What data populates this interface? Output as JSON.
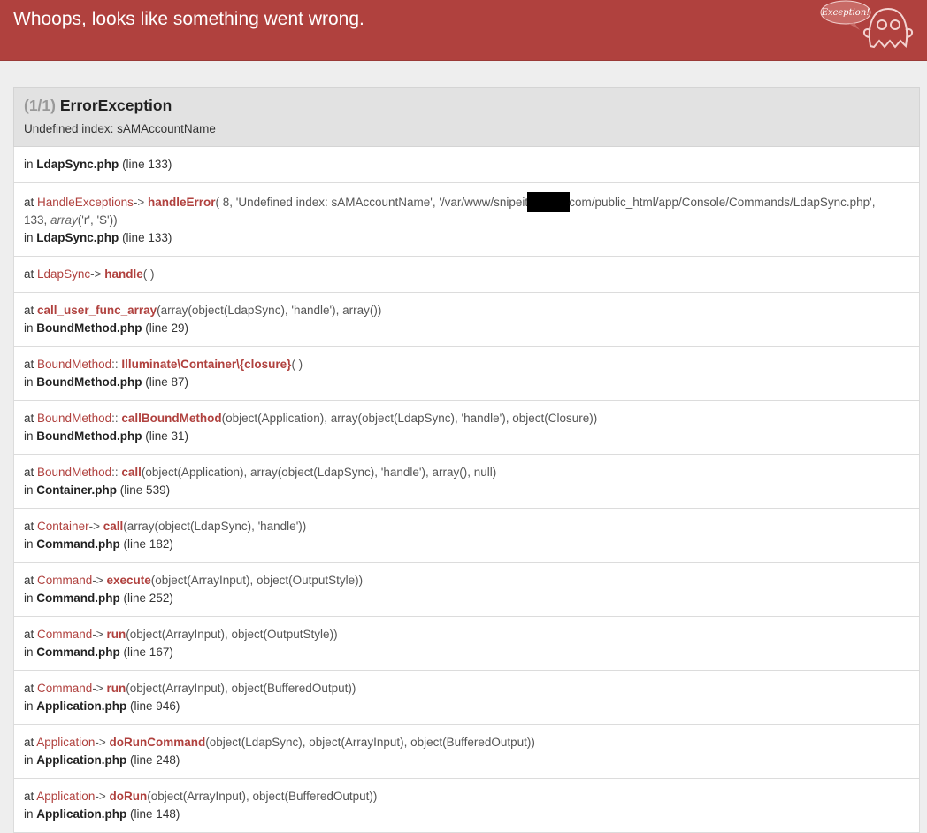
{
  "header": {
    "title": "Whoops, looks like something went wrong.",
    "logo_text": "Exception!"
  },
  "exception": {
    "count": "(1/1)",
    "type": "ErrorException",
    "message": "Undefined index: sAMAccountName",
    "origin_file": "LdapSync.php",
    "origin_line": "(line 133)"
  },
  "frames": [
    {
      "class": "HandleExceptions",
      "sep": "->",
      "func": "handleError",
      "args_a": "8, 'Undefined index: sAMAccountName', '/var/www/snipeit",
      "args_b": "com/public_html/app/Console/Commands/LdapSync.php',",
      "args_c": "133, ",
      "args_c_obj": "array",
      "args_c_rest": "('r', 'S'))",
      "file": "LdapSync.php",
      "line": "(line 133)"
    },
    {
      "class": "LdapSync",
      "sep": "->",
      "func": "handle",
      "args": "( )"
    },
    {
      "class": "",
      "sep": "",
      "func": "call_user_func_array",
      "args": "(array(object(LdapSync), 'handle'), array())",
      "file": "BoundMethod.php",
      "line": "(line 29)"
    },
    {
      "class": "BoundMethod",
      "sep": "::",
      "func": "Illuminate\\Container\\{closure}",
      "args": "( )",
      "file": "BoundMethod.php",
      "line": "(line 87)"
    },
    {
      "class": "BoundMethod",
      "sep": "::",
      "func": "callBoundMethod",
      "args": "(object(Application), array(object(LdapSync), 'handle'), object(Closure))",
      "file": "BoundMethod.php",
      "line": "(line 31)"
    },
    {
      "class": "BoundMethod",
      "sep": "::",
      "func": "call",
      "args": "(object(Application), array(object(LdapSync), 'handle'), array(), null)",
      "file": "Container.php",
      "line": "(line 539)"
    },
    {
      "class": "Container",
      "sep": "->",
      "func": "call",
      "args": "(array(object(LdapSync), 'handle'))",
      "file": "Command.php",
      "line": "(line 182)"
    },
    {
      "class": "Command",
      "sep": "->",
      "func": "execute",
      "args": "(object(ArrayInput), object(OutputStyle))",
      "file": "Command.php",
      "line": "(line 252)"
    },
    {
      "class": "Command",
      "sep": "->",
      "func": "run",
      "args": "(object(ArrayInput), object(OutputStyle))",
      "file": "Command.php",
      "line": "(line 167)"
    },
    {
      "class": "Command",
      "sep": "->",
      "func": "run",
      "args": "(object(ArrayInput), object(BufferedOutput))",
      "file": "Application.php",
      "line": "(line 946)"
    },
    {
      "class": "Application",
      "sep": "->",
      "func": "doRunCommand",
      "args": "(object(LdapSync), object(ArrayInput), object(BufferedOutput))",
      "file": "Application.php",
      "line": "(line 248)"
    },
    {
      "class": "Application",
      "sep": "->",
      "func": "doRun",
      "args": "(object(ArrayInput), object(BufferedOutput))",
      "file": "Application.php",
      "line": "(line 148)"
    }
  ],
  "labels": {
    "at": "at",
    "in": "in"
  },
  "colors": {
    "header_bg": "#b0413e",
    "accent": "#b0413e"
  }
}
